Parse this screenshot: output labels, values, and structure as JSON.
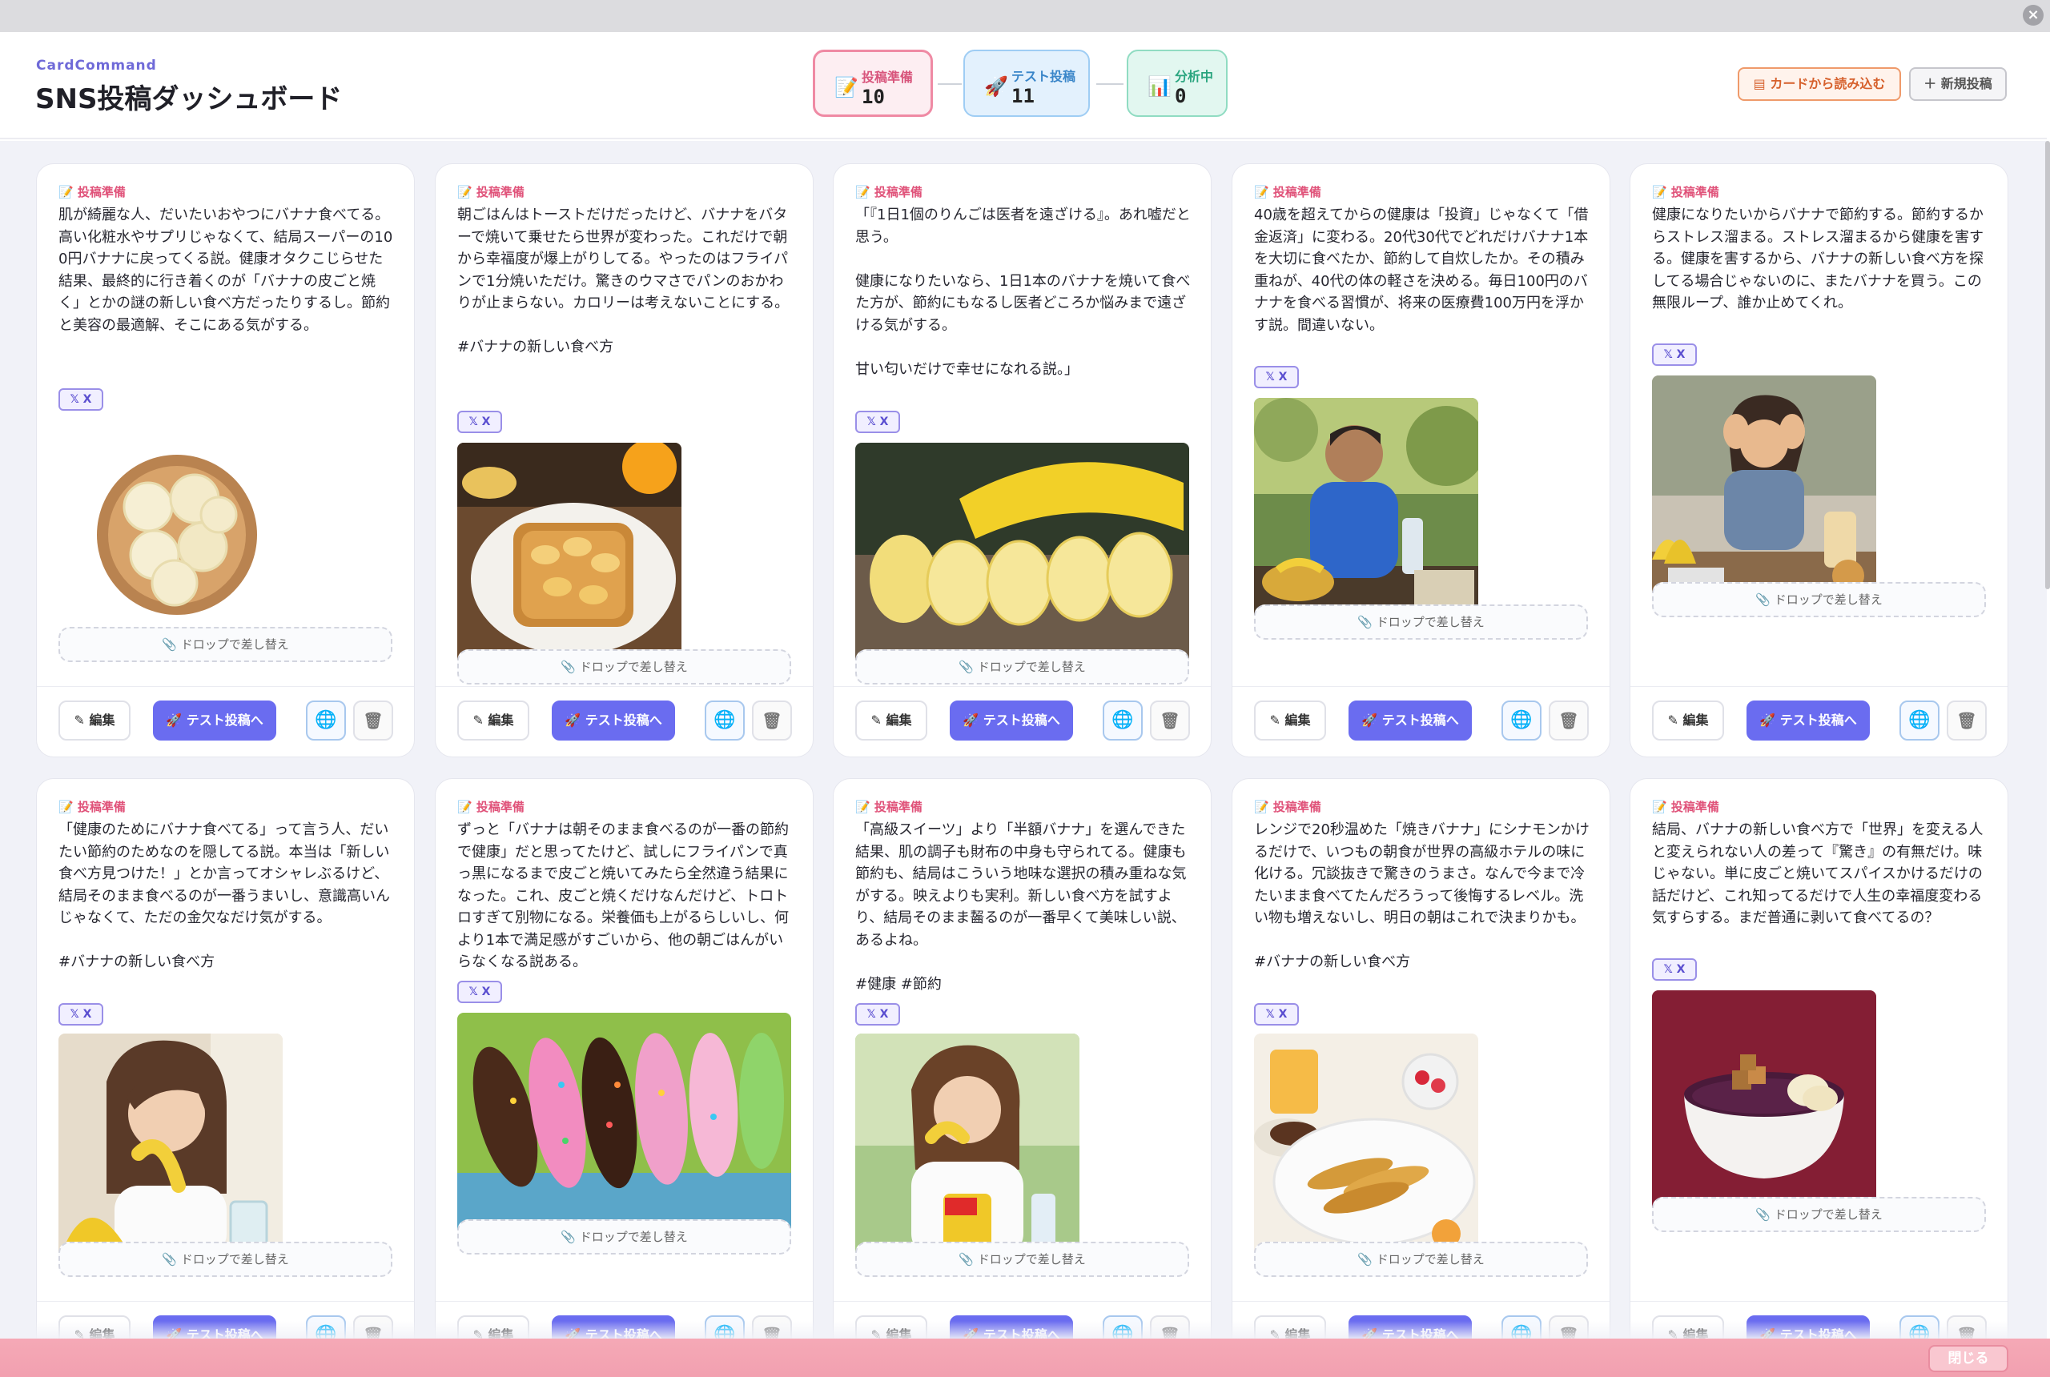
{
  "app": {
    "brand": "CardCommand",
    "title": "SNS投稿ダッシュボード",
    "close_symbol": "×"
  },
  "stages": [
    {
      "icon": "📝",
      "label": "投稿準備",
      "count": "10"
    },
    {
      "icon": "🚀",
      "label": "テスト投稿",
      "count": "11"
    },
    {
      "icon": "📊",
      "label": "分析中",
      "count": "0"
    }
  ],
  "header_buttons": {
    "import": "▤ カードから読み込む",
    "new_post": "＋ 新規投稿"
  },
  "card_labels": {
    "stage": "📝 投稿準備",
    "platform": "𝕏 X",
    "drop": "📎 ドロップで差し替え",
    "edit": "✎ 編集",
    "test_post": "🚀 テスト投稿へ",
    "globe": "🌐",
    "trash": "🗑"
  },
  "cards": [
    {
      "text": "肌が綺麗な人、だいたいおやつにバナナ食べてる。高い化粧水やサプリじゃなくて、結局スーパーの100円バナナに戻ってくる説。健康オタクこじらせた結果、最終的に行き着くのが「バナナの皮ごと焼く」とかの謎の新しい食べ方だったりするし。節約と美容の最適解、そこにある気がする。",
      "image": "banana slices in wooden bowl"
    },
    {
      "text": "朝ごはんはトーストだけだったけど、バナナをバターで焼いて乗せたら世界が変わった。これだけで朝から幸福度が爆上がりしてる。やったのはフライパンで1分焼いただけ。驚きのウマさでパンのおかわりが止まらない。カロリーは考えないことにする。\n\n#バナナの新しい食べ方",
      "image": "banana french toast"
    },
    {
      "text": "「『1日1個のりんごは医者を遠ざける』。あれ嘘だと思う。\n\n健康になりたいなら、1日1本のバナナを焼いて食べた方が、節約にもなるし医者どころか悩みまで遠ざける気がする。\n\n甘い匂いだけで幸せになれる説。」",
      "image": "sliced banana on wooden table"
    },
    {
      "text": "40歳を超えてからの健康は「投資」じゃなくて「借金返済」に変わる。20代30代でどれだけバナナ1本を大切に食べたか、節約して自炊したか。その積み重ねが、40代の体の軽さを決める。毎日100円のバナナを食べる習慣が、将来の医療費100万円を浮かす説。間違いない。",
      "image": "man eating banana in park"
    },
    {
      "text": "健康になりたいからバナナで節約する。節約するからストレス溜まる。ストレス溜まるから健康を害する。健康を害するから、バナナの新しい食べ方を探してる場合じゃないのに、またバナナを買う。この無限ループ、誰か止めてくれ。",
      "image": "stressed woman with bananas"
    },
    {
      "text": "「健康のためにバナナ食べてる」って言う人、だいたい節約のためなのを隠してる説。本当は「新しい食べ方見つけた！」とか言ってオシャレぶるけど、結局そのまま食べるのが一番うまいし、意識高いんじゃなくて、ただの金欠なだけ気がする。\n\n#バナナの新しい食べ方",
      "image": "woman eating banana"
    },
    {
      "text": "ずっと「バナナは朝そのまま食べるのが一番の節約で健康」だと思ってたけど、試しにフライパンで真っ黒になるまで皮ごと焼いてみたら全然違う結果になった。これ、皮ごと焼くだけなんだけど、トロトロすぎて別物になる。栄養価も上がるらしいし、何より1本で満足感がすごいから、他の朝ごはんがいらなくなる説ある。",
      "image": "chocolate banana stall"
    },
    {
      "text": "「高級スイーツ」より「半額バナナ」を選んできた結果、肌の調子も財布の中身も守られてる。健康も節約も、結局はこういう地味な選択の積み重ねな気がする。映えよりも実利。新しい食べ方を試すより、結局そのまま齧るのが一番早くて美味しい説、あるよね。\n\n#健康 #節約",
      "image": "woman eating half price banana"
    },
    {
      "text": "レンジで20秒温めた「焼きバナナ」にシナモンかけるだけで、いつもの朝食が世界の高級ホテルの味に化ける。冗談抜きで驚きのうまさ。なんで今まで冷たいまま食べてたんだろうって後悔するレベル。洗い物も増えないし、明日の朝はこれで決まりかも。\n\n#バナナの新しい食べ方",
      "image": "grilled banana with cinnamon"
    },
    {
      "text": "結局、バナナの新しい食べ方で「世界」を変える人と変えられない人の差って『驚き』の有無だけ。味じゃない。単に皮ごと焼いてスパイスかけるだけの話だけど、これ知ってるだけで人生の幸福度変わる気すらする。まだ普通に剥いて食べてるの？",
      "image": "acai bowl with banana"
    }
  ],
  "footer": {
    "close": "閉じる"
  }
}
